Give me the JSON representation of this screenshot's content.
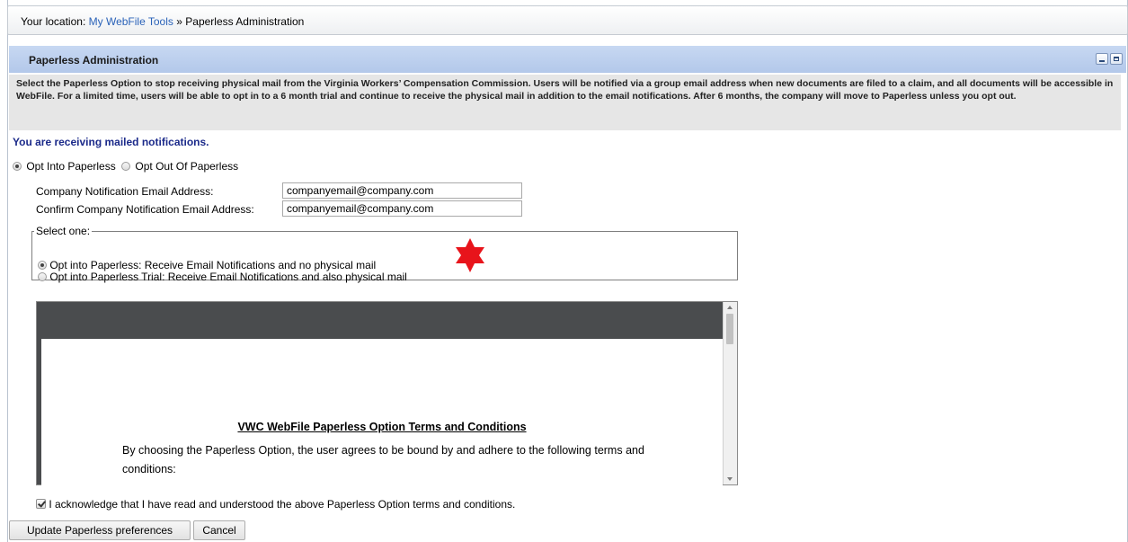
{
  "breadcrumb": {
    "prefix": "Your location:",
    "link": "My WebFile Tools",
    "separator": "»",
    "current": "Paperless Administration"
  },
  "panel": {
    "title": "Paperless Administration",
    "description": "Select the Paperless Option to stop receiving physical mail from the Virginia Workers’ Compensation Commission. Users will be notified via a group email address when new documents are filed to a claim, and all documents will be accessible in WebFile. For a limited time, users will be able to opt in to a 6 month trial and continue to receive the physical mail in addition to the email notifications. After 6 months, the company will move to Paperless unless you opt out."
  },
  "status_text": "You are receiving mailed notifications.",
  "paperless_options": {
    "opt_in_label": "Opt Into Paperless",
    "opt_out_label": "Opt Out Of Paperless",
    "selected": "opt_in"
  },
  "email_fields": {
    "company_label": "Company Notification Email Address:",
    "company_value": "companyemail@company.com",
    "confirm_label": "Confirm Company Notification Email Address:",
    "confirm_value": "companyemail@company.com"
  },
  "select_one": {
    "legend": "Select one:",
    "option1": "Opt into Paperless: Receive Email Notifications and no physical mail",
    "option2": "Opt into Paperless Trial: Receive Email Notifications and also physical mail",
    "selected": "option1"
  },
  "marker_color": "#e8141b",
  "terms": {
    "title": "VWC WebFile Paperless Option Terms and Conditions",
    "body": "By choosing the Paperless Option, the user agrees to be bound by and adhere to the following terms and conditions:"
  },
  "acknowledgement": {
    "label": "I acknowledge that I have read and understood the above Paperless Option terms and conditions.",
    "checked": true
  },
  "buttons": {
    "update": "Update Paperless preferences",
    "cancel": "Cancel"
  }
}
